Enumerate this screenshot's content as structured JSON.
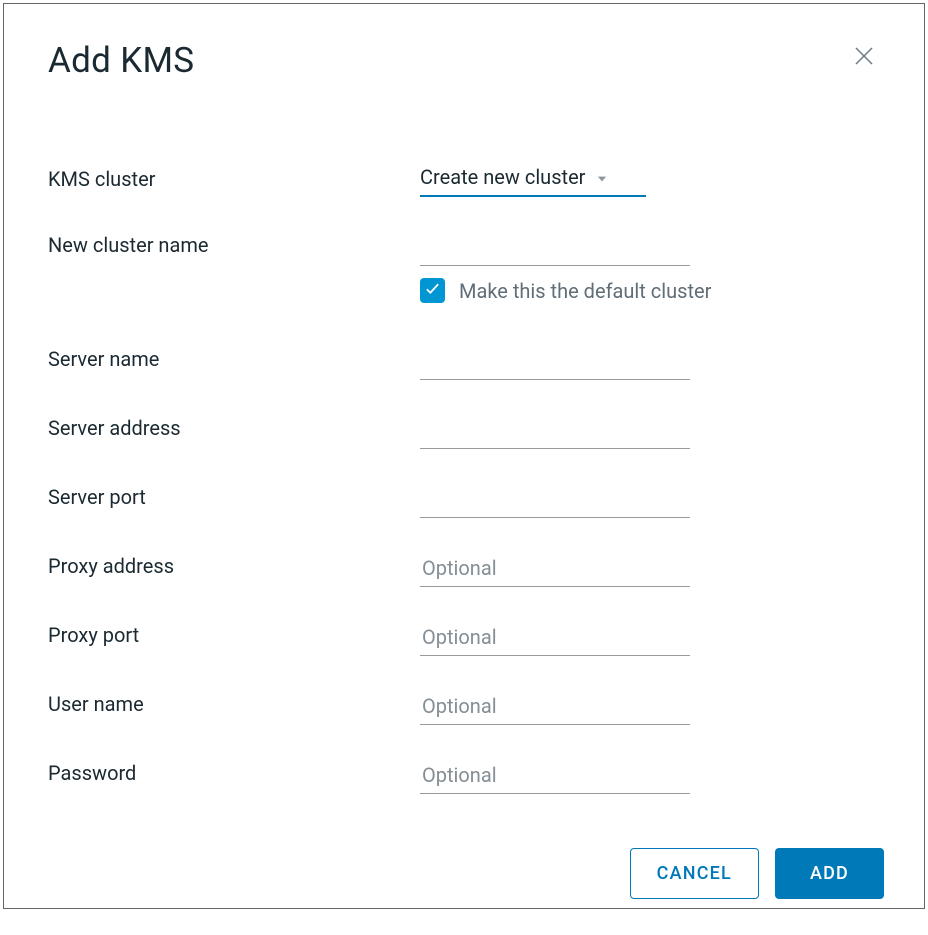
{
  "modal": {
    "title": "Add KMS",
    "form": {
      "kms_cluster": {
        "label": "KMS cluster",
        "selected": "Create new cluster"
      },
      "new_cluster_name": {
        "label": "New cluster name",
        "value": ""
      },
      "default_cluster": {
        "label": "Make this the default cluster",
        "checked": true
      },
      "server_name": {
        "label": "Server name",
        "value": ""
      },
      "server_address": {
        "label": "Server address",
        "value": ""
      },
      "server_port": {
        "label": "Server port",
        "value": ""
      },
      "proxy_address": {
        "label": "Proxy address",
        "value": "",
        "placeholder": "Optional"
      },
      "proxy_port": {
        "label": "Proxy port",
        "value": "",
        "placeholder": "Optional"
      },
      "user_name": {
        "label": "User name",
        "value": "",
        "placeholder": "Optional"
      },
      "password": {
        "label": "Password",
        "value": "",
        "placeholder": "Optional"
      }
    },
    "buttons": {
      "cancel": "CANCEL",
      "add": "ADD"
    }
  }
}
